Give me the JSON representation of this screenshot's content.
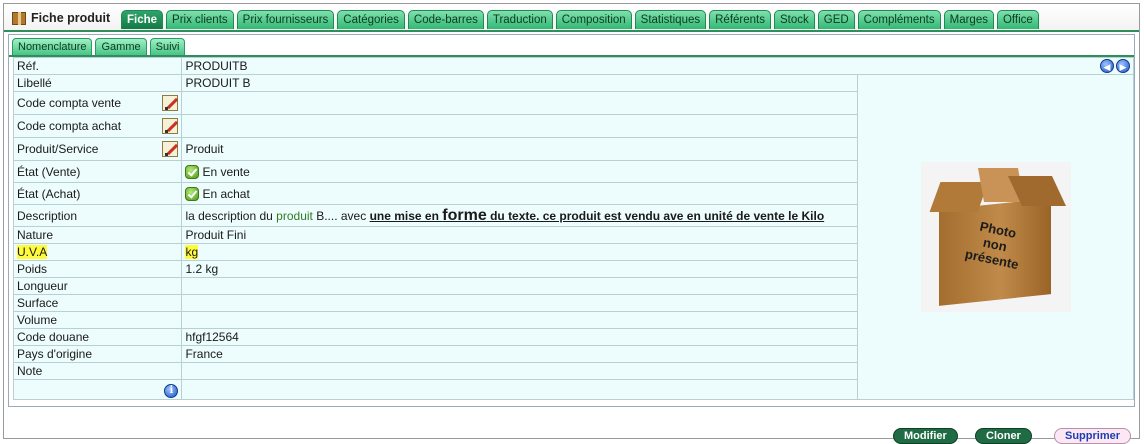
{
  "header": {
    "title": "Fiche produit",
    "tabs": [
      "Fiche",
      "Prix clients",
      "Prix fournisseurs",
      "Catégories",
      "Code-barres",
      "Traduction",
      "Composition",
      "Statistiques",
      "Référents",
      "Stock",
      "GED",
      "Compléments",
      "Marges",
      "Office"
    ],
    "active_tab": "Fiche"
  },
  "subtabs": [
    "Nomenclature",
    "Gamme",
    "Suivi"
  ],
  "fields": {
    "ref_label": "Réf.",
    "ref_value": "PRODUITB",
    "libelle_label": "Libellé",
    "libelle_value": "PRODUIT B",
    "compta_vente_label": "Code compta vente",
    "compta_achat_label": "Code compta achat",
    "produit_service_label": "Produit/Service",
    "produit_service_value": "Produit",
    "etat_vente_label": "État (Vente)",
    "etat_vente_value": "En vente",
    "etat_achat_label": "État (Achat)",
    "etat_achat_value": "En achat",
    "description_label": "Description",
    "description": {
      "part1": "la description du ",
      "part2": "produit",
      "part3": " B.... avec ",
      "part4": "une mise en ",
      "part5": "forme",
      "part6": " du texte. ce produit est vendu ave en unité de vente le Kilo"
    },
    "nature_label": "Nature",
    "nature_value": "Produit Fini",
    "uva_label": "U.V.A",
    "uva_value": "kg",
    "poids_label": "Poids",
    "poids_value": "1.2 kg",
    "longueur_label": "Longueur",
    "surface_label": "Surface",
    "volume_label": "Volume",
    "douane_label": "Code douane",
    "douane_value": "hfgf12564",
    "pays_label": "Pays d'origine",
    "pays_value": "France",
    "note_label": "Note"
  },
  "photo": {
    "line1": "Photo",
    "line2": "non",
    "line3": "présente"
  },
  "buttons": {
    "modifier": "Modifier",
    "cloner": "Cloner",
    "supprimer": "Supprimer"
  },
  "colors": {
    "tab_green": "#33b874",
    "highlight": "#fffb3a",
    "row_bg": "#edfcfc"
  },
  "icons": [
    "box-icon",
    "edit-icon",
    "check-icon",
    "info-icon",
    "arrow-left-icon",
    "arrow-right-icon"
  ]
}
